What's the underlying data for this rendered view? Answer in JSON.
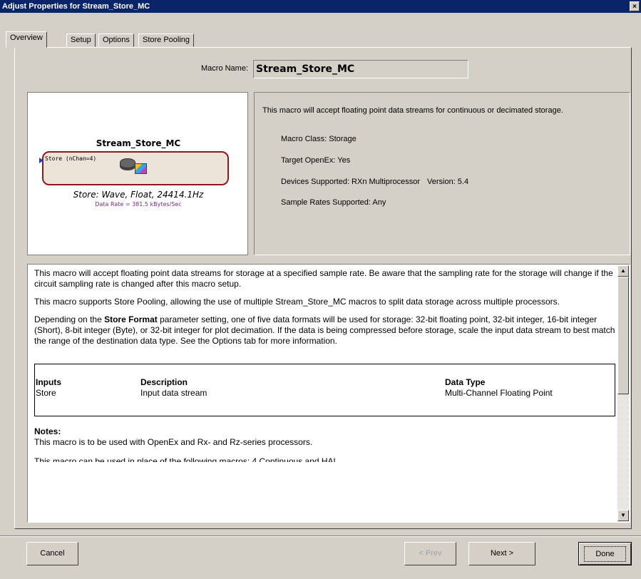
{
  "window": {
    "title": "Adjust Properties for Stream_Store_MC",
    "close": "×"
  },
  "tabs": [
    {
      "label": "Overview"
    },
    {
      "label": "Setup"
    },
    {
      "label": "Options"
    },
    {
      "label": "Store Pooling"
    }
  ],
  "macro_name": {
    "label": "Macro Name:",
    "value": "Stream_Store_MC"
  },
  "preview": {
    "title": "Stream_Store_MC",
    "port_label": "Store (nChan=4)",
    "store_info": "Store: Wave, Float, 24414.1Hz",
    "data_rate": "Data Rate = 381.5 kBytes/Sec"
  },
  "info": {
    "description": "This macro will accept floating point data streams for continuous or decimated storage.",
    "macro_class": "Macro Class:  Storage",
    "target_openex": "Target OpenEx:  Yes",
    "devices_supported": "Devices Supported:  RXn Multiprocessor",
    "version": "Version:  5.4",
    "sample_rates": "Sample Rates Supported:  Any"
  },
  "body": {
    "p1": "This macro will accept floating point data streams for storage at a specified sample rate. Be aware that the sampling rate for the storage will change if the circuit sampling rate is changed after this macro setup.",
    "p2": "This macro supports Store Pooling, allowing the use of multiple Stream_Store_MC macros to split data storage across multiple processors.",
    "p3_pre": "Depending on the ",
    "p3_bold": "Store Format",
    "p3_post": " parameter setting, one of five data formats will be used for storage: 32-bit floating point, 32-bit integer, 16-bit integer (Short), 8-bit integer (Byte), or 32-bit integer for plot decimation. If the data is being compressed before storage, scale the input data stream to best match the range of the destination data type. See the Options tab for more information.",
    "table": {
      "headers": [
        "Inputs",
        "Description",
        "Data Type"
      ],
      "row": [
        "Store",
        "Input data stream",
        "Multi-Channel Floating Point"
      ]
    },
    "notes_head": "Notes:",
    "notes_text": "This macro is  to be used with OpenEx and Rx- and Rz-series processors.",
    "cutoff_text": "This macro can be used in place of the following macros: 4 Continuous and HAL..."
  },
  "scrollbar": {
    "up": "▲",
    "down": "▼"
  },
  "buttons": {
    "cancel": "Cancel",
    "prev": "< Prev",
    "next": "Next >",
    "done": "Done"
  }
}
